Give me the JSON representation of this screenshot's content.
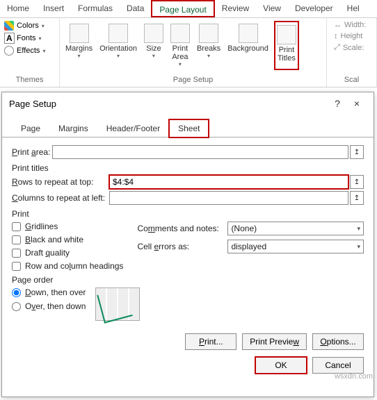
{
  "ribbon": {
    "tabs": [
      "Home",
      "Insert",
      "Formulas",
      "Data",
      "Page Layout",
      "Review",
      "View",
      "Developer",
      "Hel"
    ],
    "active_index": 4,
    "themes": {
      "colors": "Colors",
      "fonts": "Fonts",
      "effects": "Effects",
      "group_label": "Themes"
    },
    "pagesetup": {
      "buttons": [
        "Margins",
        "Orientation",
        "Size",
        "Print\nArea",
        "Breaks",
        "Background",
        "Print\nTitles"
      ],
      "highlight_index": 6,
      "group_label": "Page Setup"
    },
    "scale": {
      "width": "Width:",
      "height": "Height",
      "scale": "Scale:",
      "group_label": "Scal"
    }
  },
  "dialog": {
    "title": "Page Setup",
    "help": "?",
    "close": "×",
    "tabs": [
      "Page",
      "Margins",
      "Header/Footer",
      "Sheet"
    ],
    "active_tab_index": 3,
    "print_area_label": "Print area:",
    "print_area_value": "",
    "print_titles_section": "Print titles",
    "rows_label": "Rows to repeat at top:",
    "rows_value": "$4:$4",
    "cols_label": "Columns to repeat at left:",
    "cols_value": "",
    "print_section": "Print",
    "checks": {
      "gridlines": "Gridlines",
      "bw": "Black and white",
      "draft": "Draft quality",
      "rowcol": "Row and column headings"
    },
    "comments_label": "Comments and notes:",
    "comments_value": "(None)",
    "errors_label": "Cell errors as:",
    "errors_value": "displayed",
    "pageorder_section": "Page order",
    "order_down": "Down, then over",
    "order_over": "Over, then down",
    "buttons": {
      "print": "Print...",
      "preview": "Print Preview",
      "options": "Options...",
      "ok": "OK",
      "cancel": "Cancel"
    }
  },
  "watermark": "wsxdn.com"
}
